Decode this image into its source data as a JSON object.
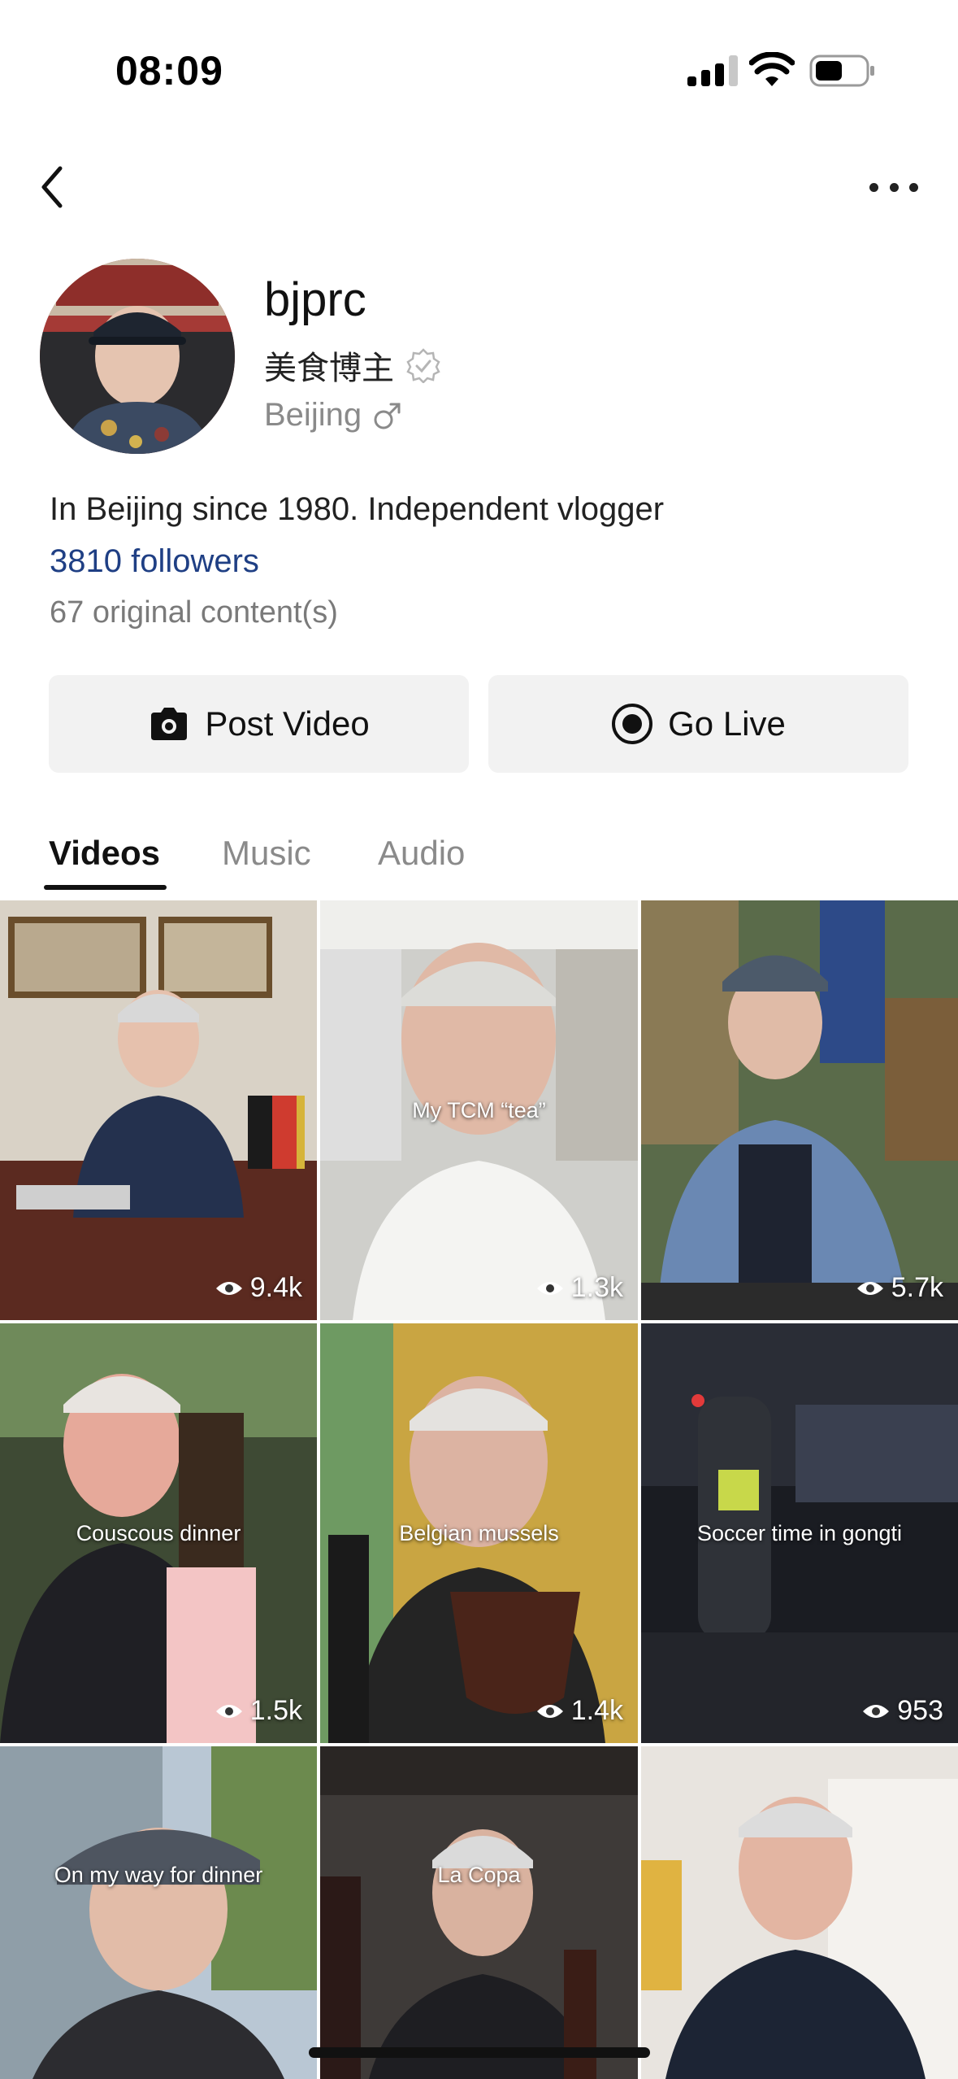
{
  "status_bar": {
    "time": "08:09"
  },
  "profile": {
    "username": "bjprc",
    "title": "美食博主",
    "location": "Beijing",
    "bio": "In Beijing since 1980. Independent vlogger",
    "followers": "3810 followers",
    "original_content": "67 original content(s)"
  },
  "actions": {
    "post_video": "Post Video",
    "go_live": "Go Live"
  },
  "tabs": [
    {
      "label": "Videos",
      "active": true
    },
    {
      "label": "Music",
      "active": false
    },
    {
      "label": "Audio",
      "active": false
    }
  ],
  "videos": [
    {
      "caption": "",
      "views": "9.4k"
    },
    {
      "caption": "My TCM “tea”",
      "views": "1.3k"
    },
    {
      "caption": "",
      "views": "5.7k"
    },
    {
      "caption": "Couscous dinner",
      "views": "1.5k"
    },
    {
      "caption": "Belgian mussels",
      "views": "1.4k"
    },
    {
      "caption": "Soccer time in gongti",
      "views": "953"
    },
    {
      "caption": "On my way for dinner",
      "views": ""
    },
    {
      "caption": "La Copa",
      "views": ""
    },
    {
      "caption": "",
      "views": ""
    }
  ],
  "colors": {
    "link": "#1f3f84",
    "button_bg": "#f2f2f2",
    "muted": "#8a8a8a"
  }
}
